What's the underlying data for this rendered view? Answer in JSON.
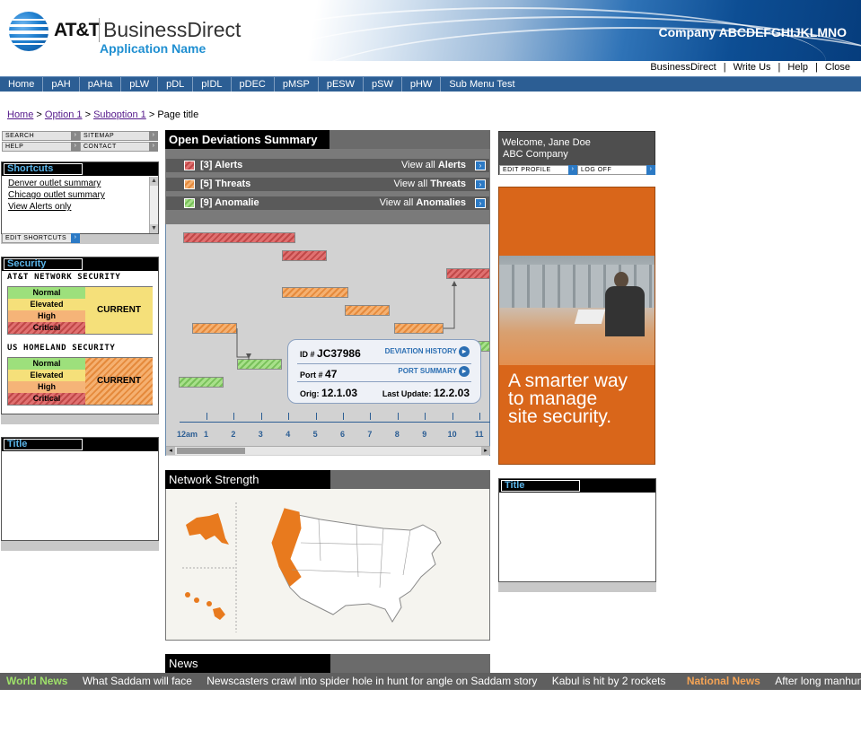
{
  "header": {
    "att_logo": "AT&T",
    "product": "BusinessDirect",
    "app_name": "Application Name",
    "company": "Company ABCDEFGHIJKLMNO",
    "util_links": [
      "BusinessDirect",
      "|",
      "Write Us",
      "|",
      "Help",
      "|",
      "Close"
    ]
  },
  "nav": [
    "Home",
    "pAH",
    "pAHa",
    "pLW",
    "pDL",
    "pIDL",
    "pDEC",
    "pMSP",
    "pESW",
    "pSW",
    "pHW",
    "Sub Menu Test"
  ],
  "breadcrumb": {
    "home": "Home",
    "sep": ">",
    "option": "Option 1",
    "suboption": "Suboption 1",
    "current": "Page title"
  },
  "tools": {
    "search": "SEARCH",
    "sitemap": "SITEMAP",
    "help": "HELP",
    "contact": "CONTACT"
  },
  "shortcuts": {
    "title": "Shortcuts",
    "items": [
      "Denver outlet summary",
      "Chicago outlet summary",
      "View Alerts only"
    ],
    "edit": "EDIT SHORTCUTS"
  },
  "security": {
    "title": "Security",
    "att_title": "AT&T NETWORK SECURITY",
    "us_title": "US HOMELAND SECURITY",
    "levels": [
      "Normal",
      "Elevated",
      "High",
      "Critical"
    ],
    "att_status": "CURRENT",
    "us_status": "CURRENT"
  },
  "left_title_panel": {
    "title": "Title"
  },
  "deviations": {
    "title": "Open Deviations Summary",
    "rows": [
      {
        "count": "[3] Alerts",
        "view_prefix": "View all",
        "view_bold": "Alerts",
        "color": "#d85a5a"
      },
      {
        "count": "[5] Threats",
        "view_prefix": "View all",
        "view_bold": "Threats",
        "color": "#f29b4c"
      },
      {
        "count": "[9] Anomalie",
        "view_prefix": "View all",
        "view_bold": "Anomalies",
        "color": "#8fd070"
      }
    ],
    "popup": {
      "id_label": "ID #",
      "id": "JC37986",
      "history": "DEVIATION HISTORY",
      "port_label": "Port #",
      "port": "47",
      "port_summary": "PORT SUMMARY",
      "orig_label": "Orig:",
      "orig": "12.1.03",
      "update_label": "Last Update:",
      "update": "12.2.03"
    },
    "axis": [
      "12am",
      "1",
      "2",
      "3",
      "4",
      "5",
      "6",
      "7",
      "8",
      "9",
      "10",
      "11"
    ]
  },
  "network_strength": {
    "title": "Network Strength"
  },
  "news": {
    "title": "News",
    "world_label": "World News",
    "world_items": [
      "What Saddam will face",
      "Newscasters crawl into spider hole in hunt for angle on Saddam story",
      "Kabul is hit by 2 rockets"
    ],
    "national_label": "National News",
    "national_items": [
      "After long manhunt,"
    ]
  },
  "welcome": {
    "greeting": "Welcome, Jane Doe",
    "company": "ABC Company",
    "edit_profile": "EDIT PROFILE",
    "logoff": "LOG OFF"
  },
  "ad": {
    "line1": "A smarter way",
    "line2": "to manage",
    "line3": "site security."
  },
  "right_title_panel": {
    "title": "Title"
  }
}
